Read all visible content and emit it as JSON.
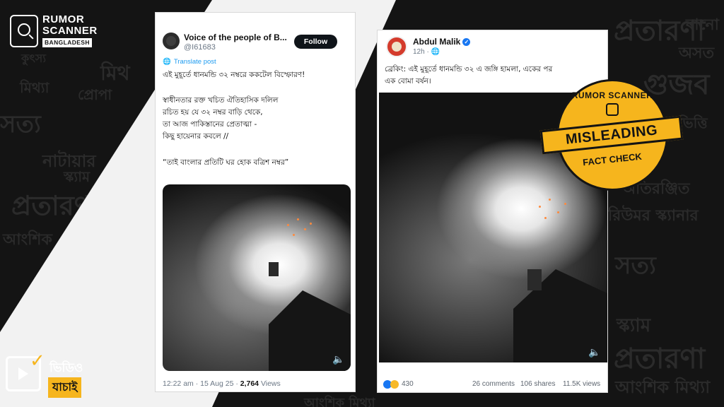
{
  "brand": {
    "line1": "RUMOR",
    "line2": "SCANNER",
    "line3": "BANGLADESH"
  },
  "background_words": [
    "সত্য",
    "মিথ্যা",
    "প্রতারণা",
    "আংশিক",
    "মিথ",
    "স্ক্যাম",
    "সত্য",
    "প্রতারণা",
    "বানো",
    "অসত",
    "গুজব",
    "ভিত্তি",
    "অতিরঞ্জিত",
    "রিউমর স্ক্যানার",
    "স্ক্যাম",
    "আংশিক মিথ্যা",
    "আংশিক মিথ্যা",
    "কুৎস্য",
    "নাটায়ার",
    "প্রোপা"
  ],
  "tweet": {
    "author": "Voice of the people of B...",
    "handle": "@I61683",
    "follow_label": "Follow",
    "translate_label": "Translate post",
    "lines": [
      "এই মুহূর্তে ধানমন্ডি ৩২ নম্বরে ককটেল বিস্ফোরণ!",
      "স্বাধীনতার রক্ত খচিত ঐতিহাসিক দলিল",
      "রচিত হয় যে ৩২ নম্বর বাড়ি থেকে,",
      "তা আজ পাকিস্তানের প্রেতাত্মা -",
      "কিছু হায়েনার কবলে //",
      "“তাই বাংলার প্রতিটি ঘর হোক বত্রিশ নম্বর”"
    ],
    "time": "12:22 am · 15 Aug 25 · ",
    "views_count": "2,764",
    "views_label": " Views"
  },
  "fb_post": {
    "author": "Abdul Malik",
    "time": "12h · ",
    "line1": "ব্রেকিং: এই মুহূর্তে ধানমন্ডি ৩২ এ জঙ্গি হামলা, একের পর",
    "line2": "এক বোমা বর্ষন।",
    "reactions": "430",
    "comments": "26 comments",
    "shares": "106 shares",
    "views": "11.5K views"
  },
  "badge": {
    "top": "RUMOR SCANNER",
    "verdict": "MISLEADING",
    "bottom": "FACT CHECK"
  },
  "video_check": {
    "line1": "ভিডিও",
    "line2": "যাচাই"
  },
  "colors": {
    "accent": "#f6b51d",
    "background": "#141414",
    "link": "#1d9bf0",
    "fb_blue": "#1877f2"
  }
}
